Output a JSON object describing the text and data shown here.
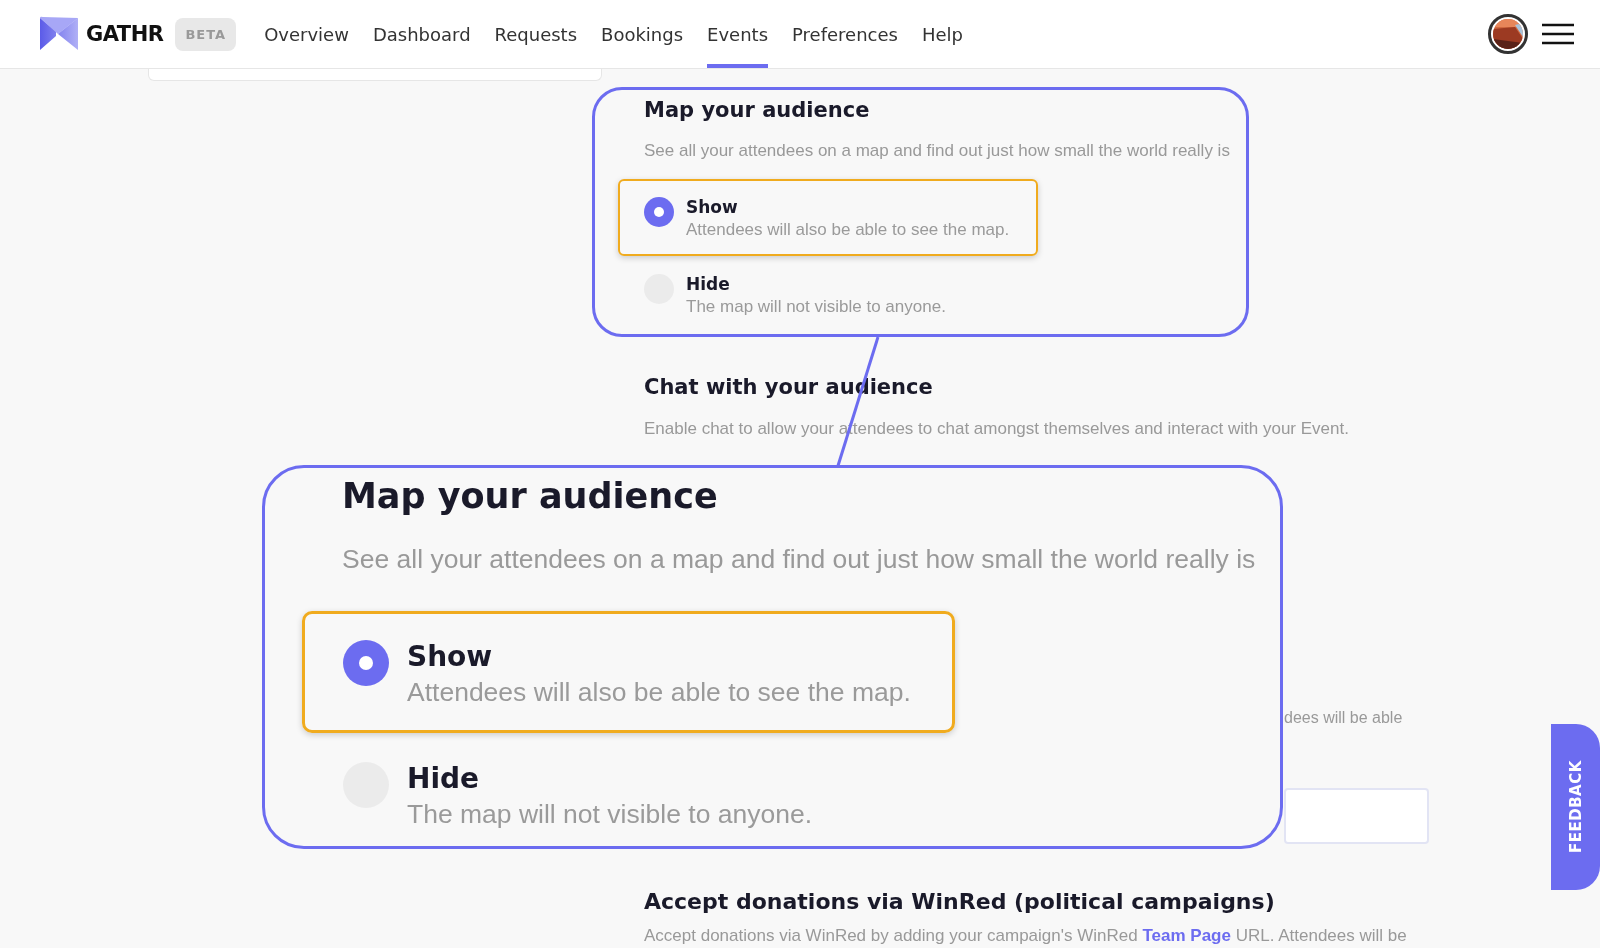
{
  "header": {
    "logo": "GATHR",
    "badge": "BETA",
    "nav": [
      {
        "label": "Overview",
        "selected": false
      },
      {
        "label": "Dashboard",
        "selected": false
      },
      {
        "label": "Requests",
        "selected": false
      },
      {
        "label": "Bookings",
        "selected": false
      },
      {
        "label": "Events",
        "selected": true
      },
      {
        "label": "Preferences",
        "selected": false
      },
      {
        "label": "Help",
        "selected": false
      }
    ]
  },
  "map_section": {
    "title": "Map your audience",
    "description": "See all your attendees on a map and find out just how small the world really is",
    "options": [
      {
        "label": "Show",
        "description": "Attendees will also be able to see the map.",
        "selected": true,
        "highlighted": true
      },
      {
        "label": "Hide",
        "description": "The map will not visible to anyone.",
        "selected": false,
        "highlighted": false
      }
    ]
  },
  "chat_section": {
    "title": "Chat with your audience",
    "description": "Enable chat to allow your attendees to chat amongst themselves and interact with your Event."
  },
  "partial_text": "dees will be able",
  "donations": {
    "title": "Accept donations via WinRed (political campaigns)",
    "description_before": "Accept donations via WinRed by adding your campaign's WinRed",
    "link": "Team Page",
    "description_after": "URL. Attendees will be"
  },
  "zoom_callout": {
    "title": "Map your audience",
    "description": "See all your attendees on a map and find out just how small the world really is",
    "options": [
      {
        "label": "Show",
        "description": "Attendees will also be able to see the map.",
        "selected": true,
        "highlighted": true
      },
      {
        "label": "Hide",
        "description": "The map will not visible to anyone.",
        "selected": false,
        "highlighted": false
      }
    ]
  },
  "feedback": "FEEDBACK"
}
